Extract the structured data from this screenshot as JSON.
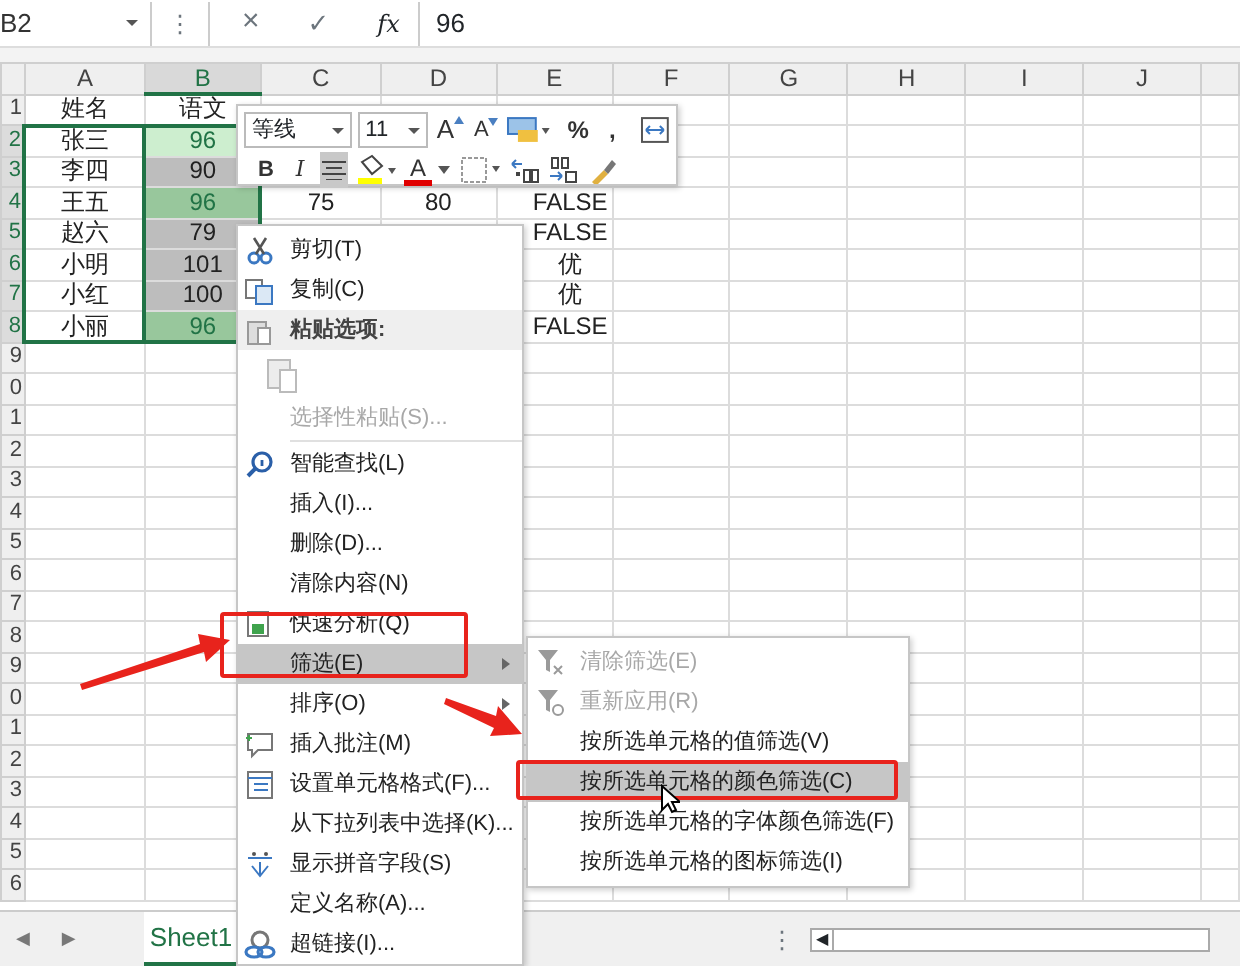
{
  "formula_bar": {
    "name_box": "B2",
    "more": "⋮",
    "cancel": "×",
    "enter": "✓",
    "fx": "fx",
    "value": "96"
  },
  "columns": [
    {
      "label": "A",
      "selected": false
    },
    {
      "label": "B",
      "selected": true
    },
    {
      "label": "C",
      "selected": false
    },
    {
      "label": "D",
      "selected": false
    },
    {
      "label": "E",
      "selected": false
    },
    {
      "label": "F",
      "selected": false
    },
    {
      "label": "G",
      "selected": false
    },
    {
      "label": "H",
      "selected": false
    },
    {
      "label": "I",
      "selected": false
    },
    {
      "label": "J",
      "selected": false
    }
  ],
  "rows": [
    {
      "label": "1",
      "selected": false,
      "cells": [
        "姓名",
        "语文",
        null,
        null,
        null
      ]
    },
    {
      "label": "2",
      "selected": true,
      "color": "#cdeecf",
      "cells": [
        "张三",
        "96",
        null,
        null,
        null
      ]
    },
    {
      "label": "3",
      "selected": true,
      "color": "#bdbdbd",
      "cells": [
        "李四",
        "90",
        null,
        null,
        null
      ]
    },
    {
      "label": "4",
      "selected": true,
      "color": "#98c79c",
      "cells": [
        "王五",
        "96",
        "75",
        "80",
        "FALSE"
      ]
    },
    {
      "label": "5",
      "selected": true,
      "color": "#bdbdbd",
      "cells": [
        "赵六",
        "79",
        null,
        null,
        "FALSE"
      ]
    },
    {
      "label": "6",
      "selected": true,
      "color": "#bdbdbd",
      "cells": [
        "小明",
        "101",
        null,
        null,
        "优"
      ]
    },
    {
      "label": "7",
      "selected": true,
      "color": "#bdbdbd",
      "cells": [
        "小红",
        "100",
        null,
        null,
        "优"
      ]
    },
    {
      "label": "8",
      "selected": true,
      "color": "#98c79c",
      "cells": [
        "小丽",
        "96",
        null,
        null,
        "FALSE"
      ]
    },
    {
      "label": "9",
      "selected": false
    },
    {
      "label": "0",
      "selected": false
    },
    {
      "label": "1",
      "selected": false
    },
    {
      "label": "2",
      "selected": false
    },
    {
      "label": "3",
      "selected": false
    },
    {
      "label": "4",
      "selected": false
    },
    {
      "label": "5",
      "selected": false
    },
    {
      "label": "6",
      "selected": false
    },
    {
      "label": "7",
      "selected": false
    },
    {
      "label": "8",
      "selected": false
    },
    {
      "label": "9",
      "selected": false
    },
    {
      "label": "0",
      "selected": false
    },
    {
      "label": "1",
      "selected": false
    },
    {
      "label": "2",
      "selected": false
    },
    {
      "label": "3",
      "selected": false
    },
    {
      "label": "4",
      "selected": false
    },
    {
      "label": "5",
      "selected": false
    },
    {
      "label": "6",
      "selected": false
    }
  ],
  "mini_toolbar": {
    "font": "等线",
    "size": "11",
    "grow_font": "A",
    "shrink_font": "A",
    "percent": "%",
    "comma": ",",
    "bold": "B",
    "italic": "I",
    "center_on": true,
    "font_color": "A"
  },
  "context_menu": [
    {
      "kind": "item",
      "label": "剪切(T)",
      "disabled": false,
      "selected": false,
      "submenu": false
    },
    {
      "kind": "item",
      "label": "复制(C)",
      "disabled": false,
      "selected": false,
      "submenu": false
    },
    {
      "kind": "header",
      "label": "粘贴选项:"
    },
    {
      "kind": "paste"
    },
    {
      "kind": "item",
      "label": "选择性粘贴(S)...",
      "disabled": true,
      "selected": false,
      "submenu": false
    },
    {
      "kind": "separator"
    },
    {
      "kind": "item",
      "label": "智能查找(L)",
      "disabled": false,
      "selected": false,
      "submenu": false
    },
    {
      "kind": "item",
      "label": "插入(I)...",
      "disabled": false,
      "selected": false,
      "submenu": false
    },
    {
      "kind": "item",
      "label": "删除(D)...",
      "disabled": false,
      "selected": false,
      "submenu": false
    },
    {
      "kind": "item",
      "label": "清除内容(N)",
      "disabled": false,
      "selected": false,
      "submenu": false
    },
    {
      "kind": "item",
      "label": "快速分析(Q)",
      "disabled": false,
      "selected": false,
      "submenu": false
    },
    {
      "kind": "item",
      "label": "筛选(E)",
      "disabled": false,
      "selected": true,
      "submenu": true
    },
    {
      "kind": "item",
      "label": "排序(O)",
      "disabled": false,
      "selected": false,
      "submenu": true
    },
    {
      "kind": "item",
      "label": "插入批注(M)",
      "disabled": false,
      "selected": false,
      "submenu": false
    },
    {
      "kind": "item",
      "label": "设置单元格格式(F)...",
      "disabled": false,
      "selected": false,
      "submenu": false
    },
    {
      "kind": "item",
      "label": "从下拉列表中选择(K)...",
      "disabled": false,
      "selected": false,
      "submenu": false
    },
    {
      "kind": "item",
      "label": "显示拼音字段(S)",
      "disabled": false,
      "selected": false,
      "submenu": false
    },
    {
      "kind": "item",
      "label": "定义名称(A)...",
      "disabled": false,
      "selected": false,
      "submenu": false
    },
    {
      "kind": "item",
      "label": "超链接(I)...",
      "disabled": false,
      "selected": false,
      "submenu": false
    }
  ],
  "submenu": [
    {
      "label": "清除筛选(E)",
      "disabled": true,
      "selected": false
    },
    {
      "label": "重新应用(R)",
      "disabled": true,
      "selected": false
    },
    {
      "label": "按所选单元格的值筛选(V)",
      "disabled": false,
      "selected": false
    },
    {
      "label": "按所选单元格的颜色筛选(C)",
      "disabled": false,
      "selected": true
    },
    {
      "label": "按所选单元格的字体颜色筛选(F)",
      "disabled": false,
      "selected": false
    },
    {
      "label": "按所选单元格的图标筛选(I)",
      "disabled": false,
      "selected": false
    }
  ],
  "sheet_bar": {
    "prev": "◀",
    "next": "▶",
    "tabs": [
      {
        "label": "Sheet1",
        "selected": true
      }
    ],
    "more": "⋮",
    "scroll_left": "◀"
  }
}
